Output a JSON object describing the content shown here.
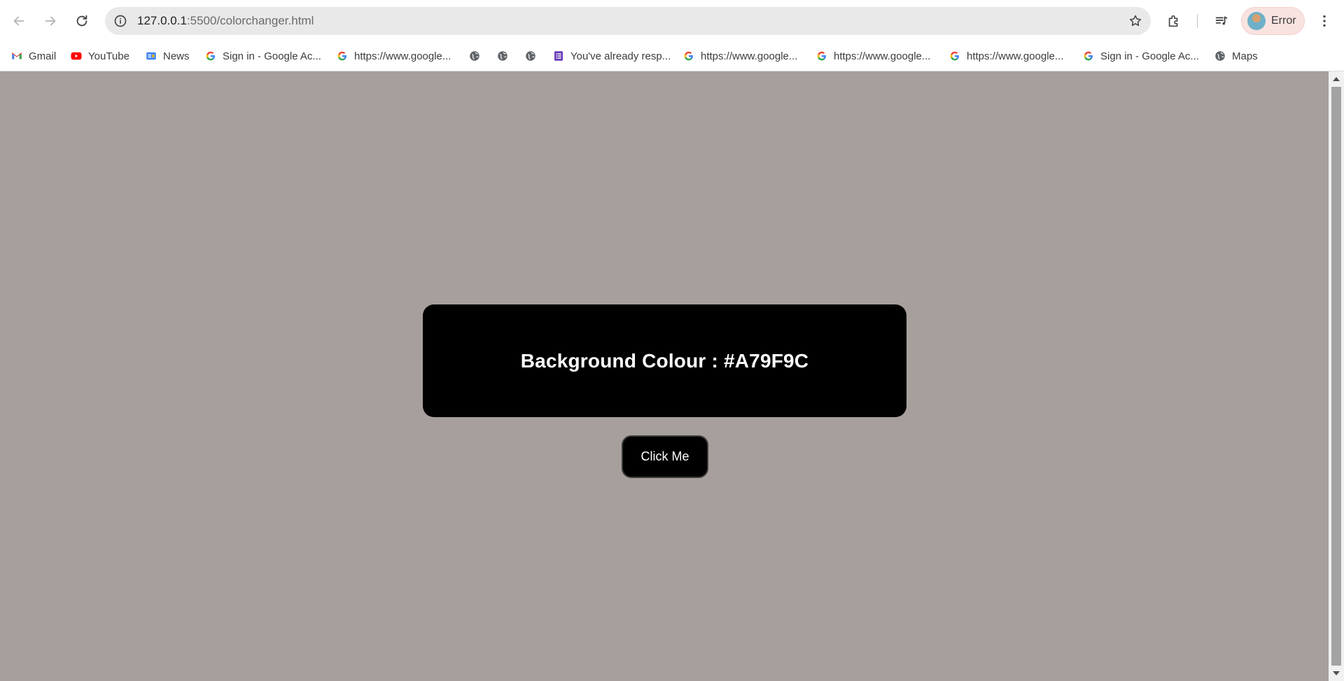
{
  "browser": {
    "url_host": "127.0.0.1",
    "url_rest": ":5500/colorchanger.html",
    "profile_label": "Error"
  },
  "bookmarks": [
    {
      "label": "Gmail",
      "icon": "gmail-icon"
    },
    {
      "label": "YouTube",
      "icon": "youtube-icon"
    },
    {
      "label": "News",
      "icon": "google-news-icon"
    },
    {
      "label": "Sign in - Google Ac...",
      "icon": "google-icon"
    },
    {
      "label": "https://www.google...",
      "icon": "google-icon"
    },
    {
      "label": "",
      "icon": "globe-icon"
    },
    {
      "label": "",
      "icon": "globe-icon"
    },
    {
      "label": "",
      "icon": "globe-icon"
    },
    {
      "label": "You've already resp...",
      "icon": "google-forms-icon"
    },
    {
      "label": "https://www.google...",
      "icon": "google-icon"
    },
    {
      "label": "https://www.google...",
      "icon": "google-icon"
    },
    {
      "label": "https://www.google...",
      "icon": "google-icon"
    },
    {
      "label": "Sign in - Google Ac...",
      "icon": "google-icon"
    },
    {
      "label": "Maps",
      "icon": "globe-icon"
    }
  ],
  "page": {
    "background_color": "#A79F9C",
    "card_text": "Background Colour : #A79F9C",
    "button_label": "Click Me"
  }
}
